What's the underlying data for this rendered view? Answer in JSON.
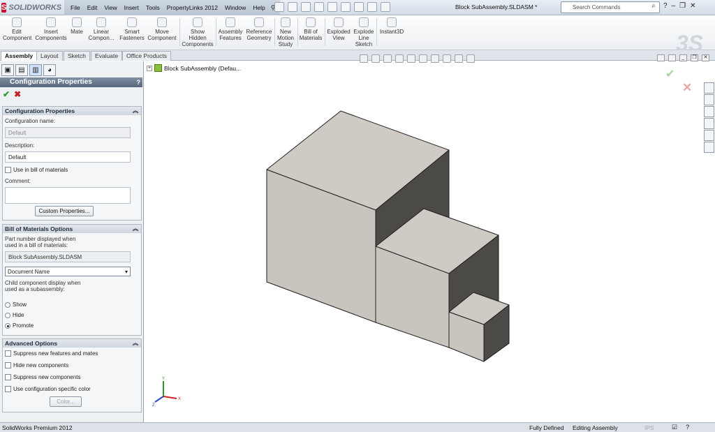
{
  "app": {
    "logo_text": "SOLIDWORKS",
    "document_title": "Block SubAssembly.SLDASM *",
    "search_placeholder": "Search Commands",
    "menus": [
      "File",
      "Edit",
      "View",
      "Insert",
      "Tools",
      "PropertyLinks 2012",
      "Window",
      "Help"
    ]
  },
  "ribbon": {
    "buttons": [
      {
        "label": "Edit\nComponent"
      },
      {
        "label": "Insert\nComponents"
      },
      {
        "label": "Mate"
      },
      {
        "label": "Linear\nCompon..."
      },
      {
        "label": "Smart\nFasteners"
      },
      {
        "label": "Move\nComponent"
      },
      {
        "label": "Show\nHidden\nComponents"
      },
      {
        "label": "Assembly\nFeatures"
      },
      {
        "label": "Reference\nGeometry"
      },
      {
        "label": "New\nMotion\nStudy"
      },
      {
        "label": "Bill of\nMaterials"
      },
      {
        "label": "Exploded\nView"
      },
      {
        "label": "Explode\nLine\nSketch"
      },
      {
        "label": "Instant3D"
      }
    ]
  },
  "tabs": [
    "Assembly",
    "Layout",
    "Sketch",
    "Evaluate",
    "Office Products"
  ],
  "property_manager": {
    "title": "Configuration Properties",
    "help": "?",
    "config_group": {
      "header": "Configuration Properties",
      "name_label": "Configuration name:",
      "name_value": "Default",
      "description_label": "Description:",
      "description_value": "Default",
      "use_in_bom_label": "Use in bill of materials",
      "comment_label": "Comment:",
      "custom_properties_button": "Custom Properties..."
    },
    "bom_group": {
      "header": "Bill of Materials Options",
      "part_number_label_1": "Part number displayed when",
      "part_number_label_2": "used in a bill of materials:",
      "part_number_value": "Block SubAssembly.SLDASM",
      "source_selected": "Document Name",
      "child_label_1": "Child component display when",
      "child_label_2": "used as a subassembly:",
      "options": [
        "Show",
        "Hide",
        "Promote"
      ],
      "selected_option": "Promote"
    },
    "advanced_group": {
      "header": "Advanced Options",
      "suppress_features_label": "Suppress new features and mates",
      "hide_components_label": "Hide new components",
      "suppress_components_label": "Suppress new components",
      "config_color_label": "Use configuration specific color",
      "color_button": "Color..."
    }
  },
  "viewport": {
    "tree_root_label": "Block SubAssembly  (Defau..."
  },
  "status_bar": {
    "product": "SolidWorks Premium 2012",
    "fully_defined": "Fully Defined",
    "editing": "Editing Assembly",
    "ips": "IPS"
  },
  "colors": {
    "face_top": "#cfcac4",
    "face_front": "#c8c4bd",
    "face_side": "#4c4a47",
    "edge": "#1e1e1e"
  }
}
